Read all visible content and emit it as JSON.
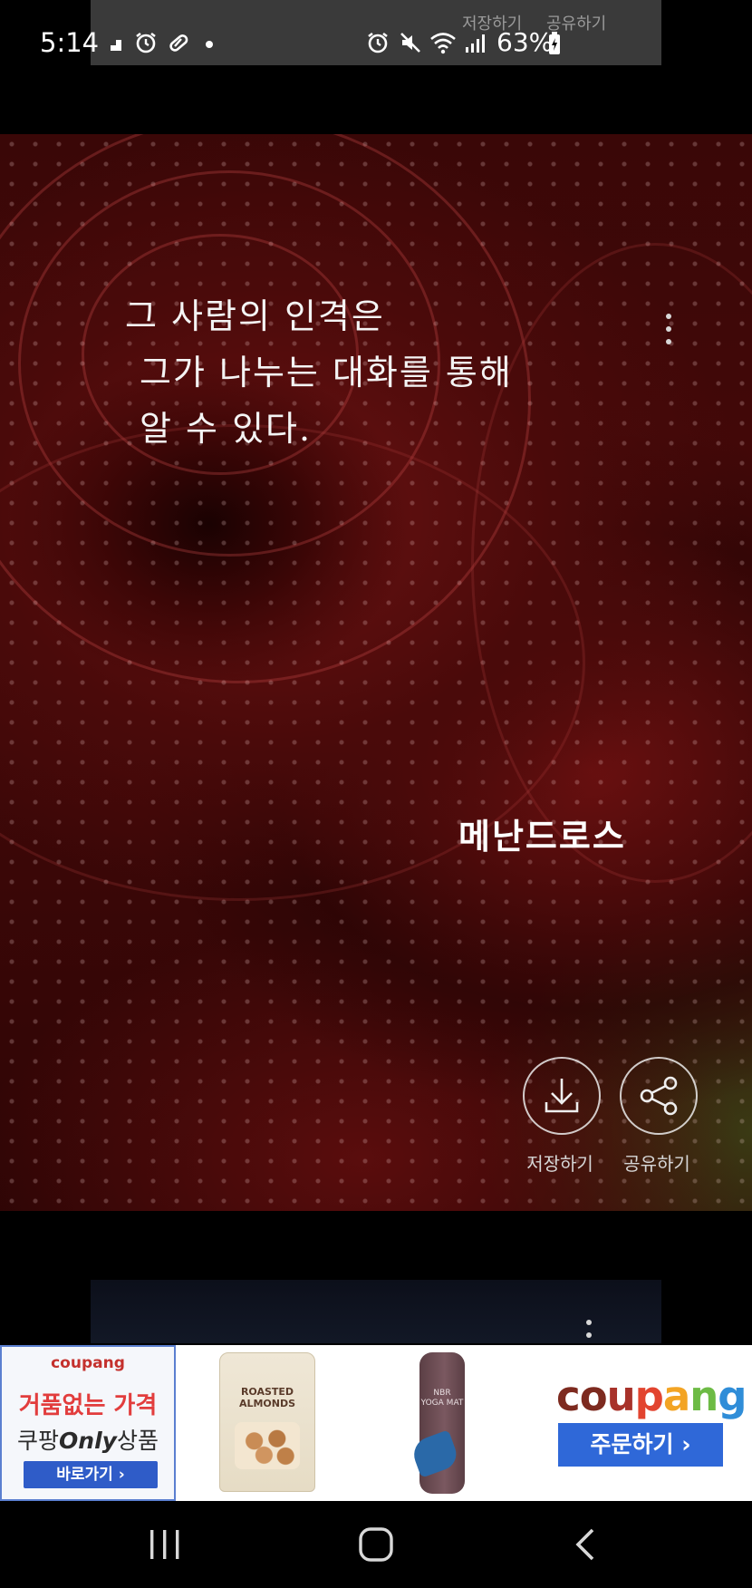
{
  "status_bar": {
    "time": "5:14",
    "battery": "63%",
    "overlay_labels": [
      "저장하기",
      "공유하기"
    ]
  },
  "card": {
    "quote_lines": [
      "그 사람의 인격은",
      "그가 나누는 대화를 통해",
      "알 수 있다."
    ],
    "author": "메난드로스",
    "save_label": "저장하기",
    "share_label": "공유하기"
  },
  "ad": {
    "brand_small": "coupang",
    "headline": "거품없는 가격",
    "subline_prefix": "쿠팡",
    "subline_only": "Only",
    "subline_suffix": "상품",
    "goto_label": "바로가기 ›",
    "almond_label": [
      "ROASTED",
      "ALMONDS"
    ],
    "yoga_label": [
      "NBR",
      "YOGA MAT"
    ],
    "logo_letters": [
      "c",
      "o",
      "u",
      "p",
      "a",
      "n",
      "g"
    ],
    "logo_colors": [
      "#7d2a1f",
      "#7d2a1f",
      "#a8322a",
      "#e2442f",
      "#f3a424",
      "#6dbb45",
      "#2f8dd8"
    ],
    "order_label": "주문하기 ›"
  },
  "icons": {
    "save": "download-icon",
    "share": "share-icon",
    "menu": "more-vertical-icon"
  }
}
